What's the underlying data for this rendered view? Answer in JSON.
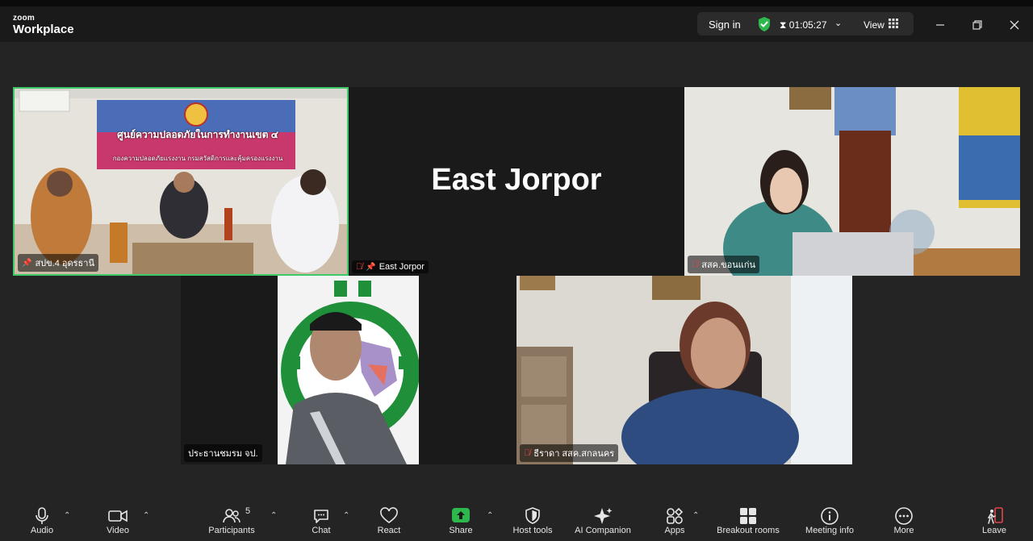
{
  "app": {
    "brand_small": "zoom",
    "brand_large": "Workplace"
  },
  "header": {
    "sign_in": "Sign in",
    "timer": "01:05:27",
    "view": "View",
    "colors": {
      "shield": "#2db84d"
    }
  },
  "main_tile": {
    "banner_title": "ศูนย์ความปลอดภัยในการทำงานเขต ๔",
    "banner_subtitle": "กองความปลอดภัยแรงงาน กรมสวัสดิการและคุ้มครองแรงงาน"
  },
  "participants": [
    {
      "name": "สปข.4 อุดรธานี",
      "muted": false,
      "pinned": true
    },
    {
      "name": "East Jorpor",
      "display": "East Jorpor",
      "muted": true,
      "pinned": true
    },
    {
      "name": "สสค.ขอนแก่น",
      "muted": true,
      "pinned": false
    },
    {
      "name": "ประธานชมรม จป.",
      "muted": false,
      "pinned": false
    },
    {
      "name": "ธีราดา สสค.สกลนคร",
      "muted": true,
      "pinned": false
    }
  ],
  "toolbar": {
    "audio": "Audio",
    "video": "Video",
    "participants": "Participants",
    "participants_count": "5",
    "chat": "Chat",
    "react": "React",
    "share": "Share",
    "host_tools": "Host tools",
    "ai_companion": "AI Companion",
    "apps": "Apps",
    "breakout": "Breakout rooms",
    "meeting_info": "Meeting info",
    "more": "More",
    "leave": "Leave"
  }
}
